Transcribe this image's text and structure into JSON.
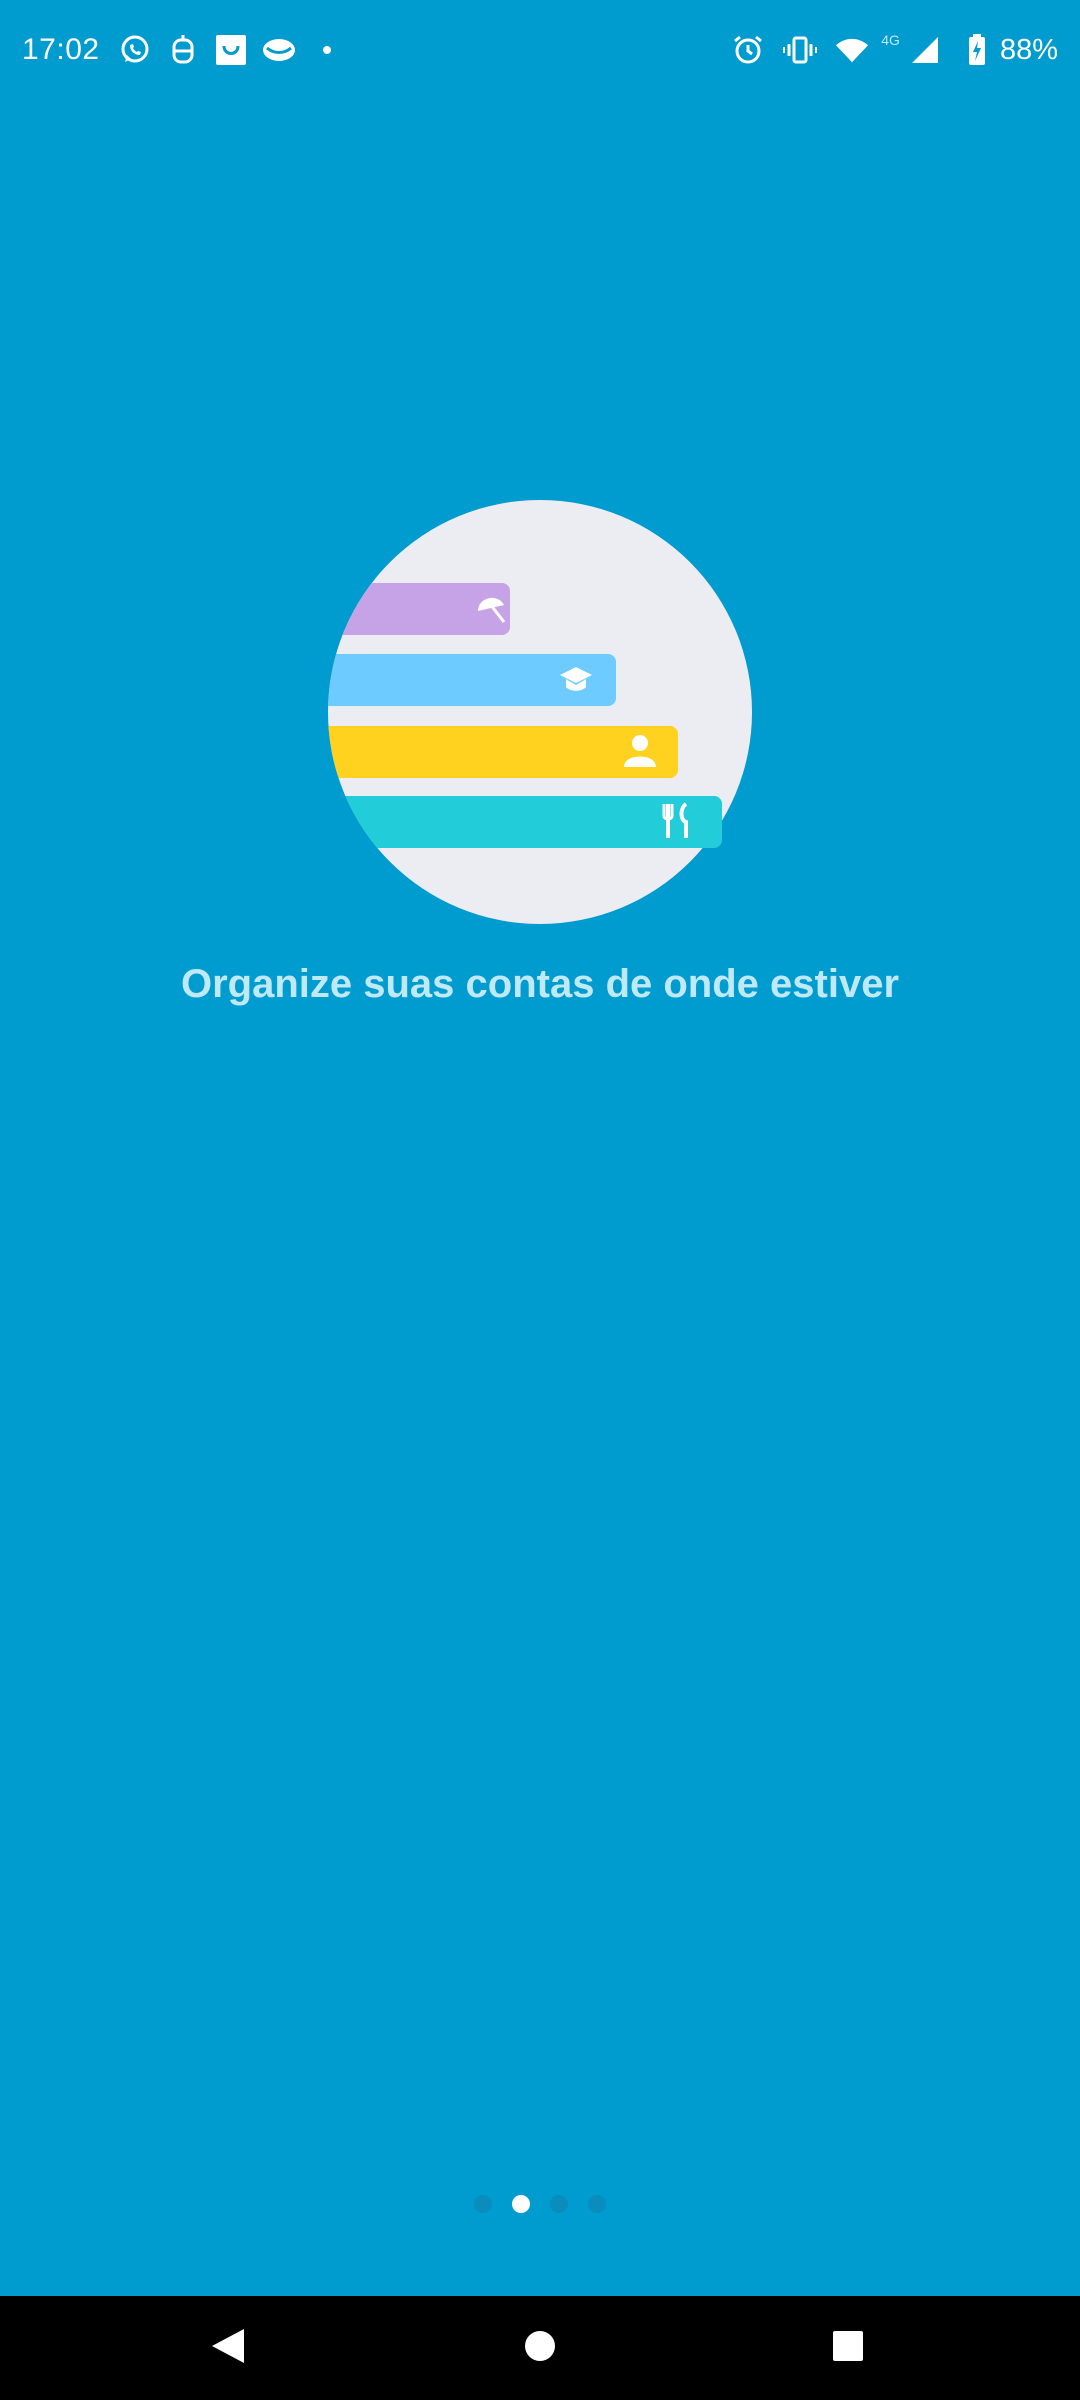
{
  "status_bar": {
    "time": "17:02",
    "network_label": "4G",
    "battery": "88%",
    "left_icons": [
      "whatsapp-icon",
      "robot-icon",
      "bag-icon",
      "cloud-app-icon",
      "dot-icon"
    ],
    "right_icons": [
      "alarm-icon",
      "vibrate-icon",
      "wifi-icon",
      "signal-icon",
      "battery-charging-icon"
    ]
  },
  "onboarding": {
    "headline": "Organize suas contas de onde estiver",
    "illustration_bars": [
      {
        "color": "#C5A3E6",
        "icon": "umbrella-icon"
      },
      {
        "color": "#6ECBFF",
        "icon": "graduation-cap-icon"
      },
      {
        "color": "#FFD21F",
        "icon": "person-icon"
      },
      {
        "color": "#22CCD8",
        "icon": "utensils-icon"
      }
    ],
    "illustration_circle_color": "#EBEDF2",
    "page_count": 4,
    "current_page": 2
  },
  "nav_bar": {
    "back": "back-icon",
    "home": "home-icon",
    "recents": "recents-icon"
  },
  "colors": {
    "background": "#009BCF",
    "headline": "#BFE9F7",
    "indicator_active": "#FFFFFF",
    "indicator_inactive": "#0A8CBD"
  }
}
